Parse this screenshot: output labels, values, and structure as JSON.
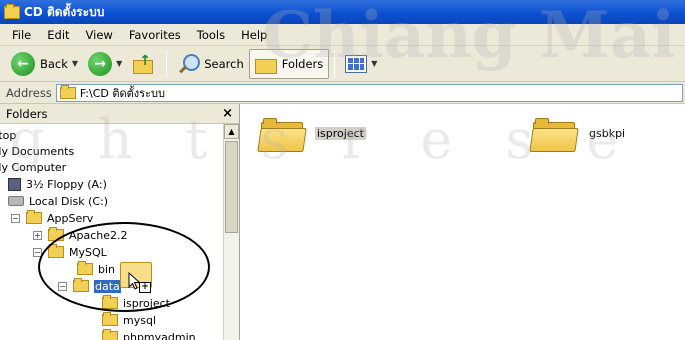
{
  "window": {
    "title": "CD ติดตั้งระบบ"
  },
  "menu": [
    "File",
    "Edit",
    "View",
    "Favorites",
    "Tools",
    "Help"
  ],
  "toolbar": {
    "back_label": "Back",
    "search_label": "Search",
    "folders_label": "Folders"
  },
  "address": {
    "label": "Address",
    "value": "F:\\CD ติดตั้งระบบ"
  },
  "folders_pane": {
    "title": "Folders",
    "close": "×",
    "tree": [
      {
        "label": "ktop"
      },
      {
        "label": "My Documents"
      },
      {
        "label": "My Computer"
      },
      {
        "label": "3½ Floppy (A:)"
      },
      {
        "label": "Local Disk (C:)"
      },
      {
        "label": "AppServ",
        "expander": "⊟"
      },
      {
        "label": "Apache2.2",
        "expander": "⊞"
      },
      {
        "label": "MySQL",
        "expander": "⊟"
      },
      {
        "label": "bin"
      },
      {
        "label": "data",
        "expander": "⊟",
        "selected": true
      },
      {
        "label": "isproject"
      },
      {
        "label": "mysql"
      },
      {
        "label": "phpmyadmin"
      }
    ]
  },
  "drag": {
    "plus": "+"
  },
  "content": {
    "items": [
      {
        "label": "isproject",
        "highlighted": true
      },
      {
        "label": "gsbkpi",
        "highlighted": false
      }
    ]
  },
  "watermark": {
    "line1": "Chiang Mai Un",
    "line2": "g h t s   r e s e"
  }
}
